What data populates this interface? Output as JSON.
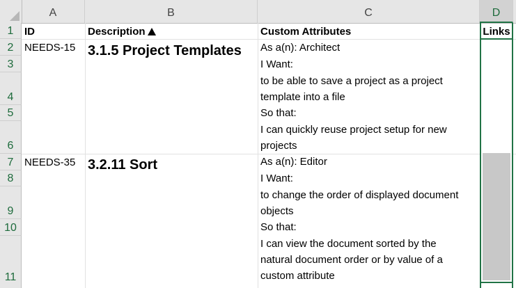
{
  "columns": [
    "A",
    "B",
    "C",
    "D"
  ],
  "rows": [
    "1",
    "2",
    "3",
    "4",
    "5",
    "6",
    "7",
    "8",
    "9",
    "10",
    "11"
  ],
  "headers": {
    "id": "ID",
    "description": "Description",
    "custom_attributes": "Custom Attributes",
    "links": "Links"
  },
  "records": [
    {
      "id": "NEEDS-15",
      "description": "3.1.5 Project Templates",
      "attributes": [
        "As a(n): Architect",
        "I Want:",
        "to be able to save a project as a project",
        "template into a file",
        "So that:",
        "I can quickly reuse project setup for new",
        "projects"
      ]
    },
    {
      "id": "NEEDS-35",
      "description": "3.2.11 Sort",
      "attributes": [
        "As a(n): Editor",
        "I Want:",
        "to change the order of displayed document",
        "objects",
        "So that:",
        "I can view the document sorted by the",
        "natural document order or by value of a",
        "custom attribute"
      ]
    }
  ],
  "colors": {
    "accent": "#217346",
    "header_bg": "#e6e6e6"
  }
}
